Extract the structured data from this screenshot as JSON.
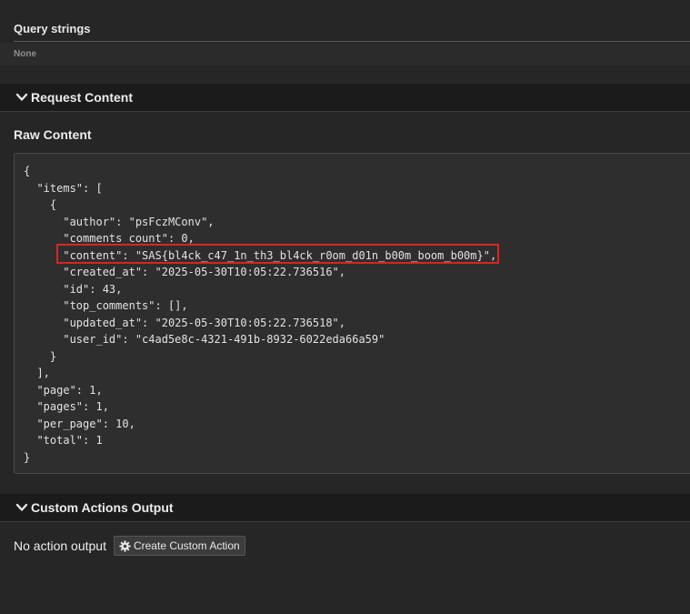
{
  "query": {
    "title": "Query strings",
    "value": "None"
  },
  "request_section": {
    "label": "Request Content"
  },
  "raw": {
    "title": "Raw Content",
    "lines": [
      "{",
      "  \"items\": [",
      "    {",
      "      \"author\": \"psFczMConv\",",
      "      \"comments_count\": 0,",
      "      \"content\": \"SAS{bl4ck_c47_1n_th3_bl4ck_r0om_d01n_b00m_boom_b00m}\",",
      "      \"created_at\": \"2025-05-30T10:05:22.736516\",",
      "      \"id\": 43,",
      "      \"top_comments\": [],",
      "      \"updated_at\": \"2025-05-30T10:05:22.736518\",",
      "      \"user_id\": \"c4ad5e8c-4321-491b-8932-6022eda66a59\"",
      "    }",
      "  ],",
      "  \"page\": 1,",
      "  \"pages\": 1,",
      "  \"per_page\": 10,",
      "  \"total\": 1",
      "}"
    ]
  },
  "actions_section": {
    "label": "Custom Actions Output"
  },
  "actions": {
    "empty_text": "No action output",
    "create_button_label": "Create Custom Action",
    "create_button_icon": "gear-icon"
  },
  "colors": {
    "highlight": "#d9261c",
    "header_bg": "#1b1b1b",
    "page_bg": "#262626"
  }
}
